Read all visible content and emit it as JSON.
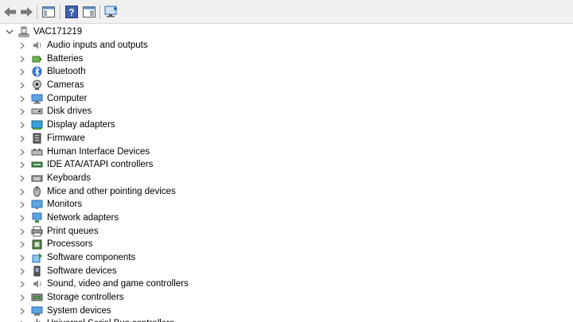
{
  "toolbar": {
    "buttons": [
      "back-arrow-icon",
      "forward-arrow-icon",
      "show-hide-console-tree-icon",
      "help-icon",
      "properties-pane-icon",
      "scan-hardware-icon"
    ]
  },
  "tree": {
    "root": "VAC171219",
    "items": [
      {
        "label": "Audio inputs and outputs",
        "icon": "speaker-icon"
      },
      {
        "label": "Batteries",
        "icon": "battery-icon"
      },
      {
        "label": "Bluetooth",
        "icon": "bluetooth-icon"
      },
      {
        "label": "Cameras",
        "icon": "camera-icon"
      },
      {
        "label": "Computer",
        "icon": "computer-icon"
      },
      {
        "label": "Disk drives",
        "icon": "disk-drive-icon"
      },
      {
        "label": "Display adapters",
        "icon": "display-adapter-icon"
      },
      {
        "label": "Firmware",
        "icon": "firmware-icon"
      },
      {
        "label": "Human Interface Devices",
        "icon": "hid-icon"
      },
      {
        "label": "IDE ATA/ATAPI controllers",
        "icon": "ide-controller-icon"
      },
      {
        "label": "Keyboards",
        "icon": "keyboard-icon"
      },
      {
        "label": "Mice and other pointing devices",
        "icon": "mouse-icon"
      },
      {
        "label": "Monitors",
        "icon": "monitor-icon"
      },
      {
        "label": "Network adapters",
        "icon": "network-adapter-icon"
      },
      {
        "label": "Print queues",
        "icon": "printer-icon"
      },
      {
        "label": "Processors",
        "icon": "processor-icon"
      },
      {
        "label": "Software components",
        "icon": "software-component-icon"
      },
      {
        "label": "Software devices",
        "icon": "software-device-icon"
      },
      {
        "label": "Sound, video and game controllers",
        "icon": "sound-controller-icon"
      },
      {
        "label": "Storage controllers",
        "icon": "storage-controller-icon"
      },
      {
        "label": "System devices",
        "icon": "system-device-icon"
      },
      {
        "label": "Universal Serial Bus controllers",
        "icon": "usb-icon"
      }
    ]
  }
}
